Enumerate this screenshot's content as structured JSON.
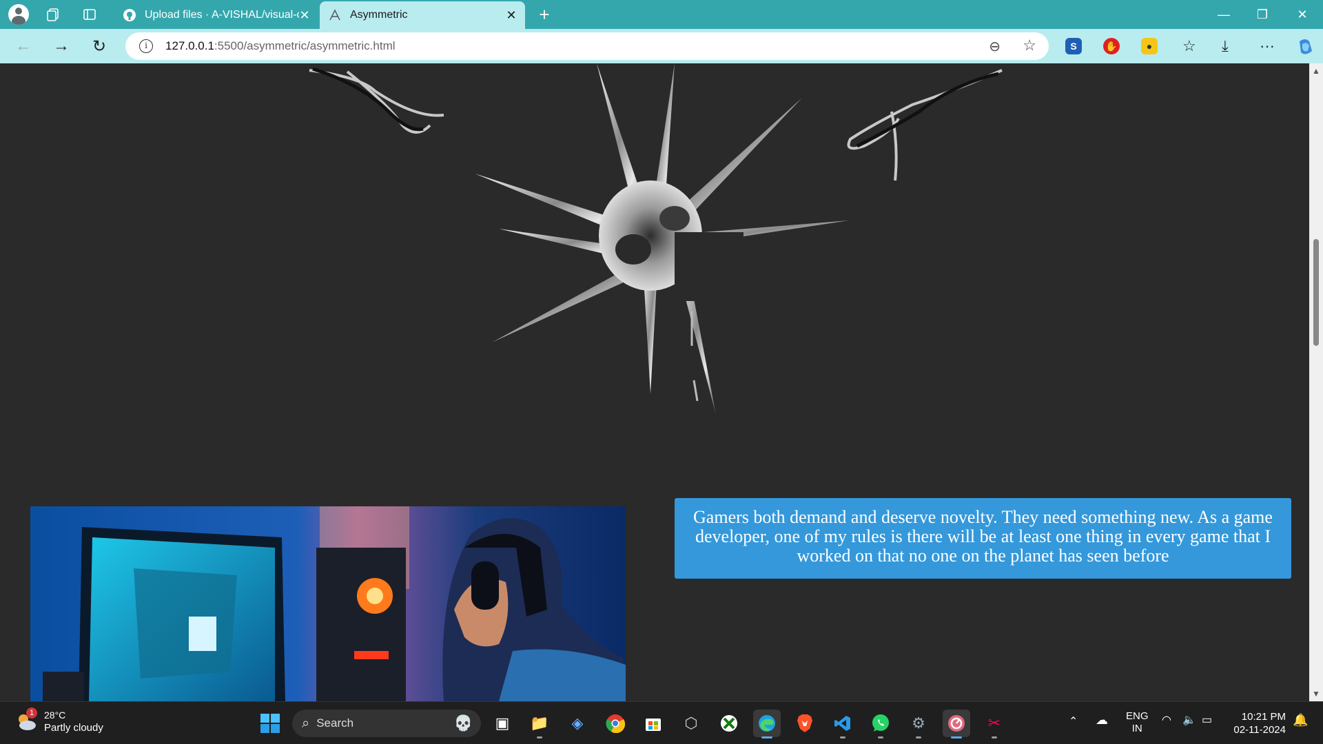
{
  "browser": {
    "tabs": [
      {
        "title": "Upload files · A-VISHAL/visual-co",
        "favicon": "github-icon",
        "active": false
      },
      {
        "title": "Asymmetric",
        "favicon": "asymmetric-logo-icon",
        "active": true
      }
    ],
    "url_host": "127.0.0.1",
    "url_path": ":5500/asymmetric/asymmetric.html"
  },
  "page": {
    "quote": "Gamers both demand and deserve novelty. They need something new. As a game developer, one of my rules is there will be at least one thing in every game that I worked on that no one on the planet has seen before",
    "quote_bg": "#3498db",
    "background": "#2a2a2a"
  },
  "taskbar": {
    "weather_temp": "28°C",
    "weather_condition": "Partly cloudy",
    "weather_badge": "1",
    "search_label": "Search",
    "lang_line1": "ENG",
    "lang_line2": "IN",
    "time": "10:21 PM",
    "date": "02-11-2024"
  }
}
